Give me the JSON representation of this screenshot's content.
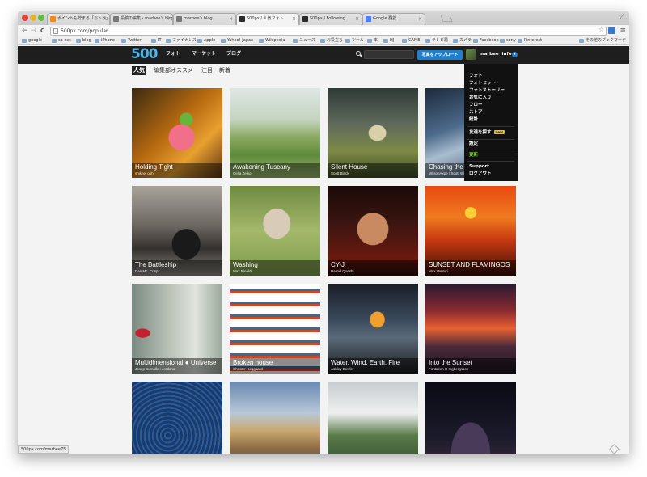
{
  "browser": {
    "tabs": [
      {
        "label": "ポイントも貯まる「おトク」",
        "color": "#f08a24"
      },
      {
        "label": "投稿の編集 ‹ marbee's blog",
        "color": "#777777"
      },
      {
        "label": "marbee's blog",
        "color": "#777777"
      },
      {
        "label": "500px / 人気フォト",
        "color": "#2a2a2a"
      },
      {
        "label": "500px / Following",
        "color": "#2a2a2a"
      },
      {
        "label": "Google 翻訳",
        "color": "#4285f4"
      }
    ],
    "tab_close": "×",
    "active_tab_index": 3,
    "url": "500px.com/popular",
    "status_url": "500px.com/marbee75",
    "bookmarks": [
      "google",
      "so-net",
      "blog",
      "iPhone",
      "Twitter",
      "IT",
      "ファイナンス",
      "Apple",
      "Yahoo! Japan",
      "Wikipedia",
      "ニュース",
      "お役立ち",
      "ツール",
      "本",
      "HJ",
      "CAME",
      "テレビ局",
      "カメラ",
      "Facebook",
      "sony",
      "Pinterest"
    ],
    "bookmarks_other": "その他のブックマーク",
    "icons": {
      "back": "←",
      "forward": "→",
      "reload": "C",
      "star": "☆",
      "menu": "≡",
      "fullscreen": "⤢"
    }
  },
  "site": {
    "logo": "500",
    "brand_color": "#4fb3e8",
    "nav": [
      "フォト",
      "マーケット",
      "ブログ"
    ],
    "search_placeholder": "",
    "upload_label": "写真をアップロード",
    "username": "marbee .info",
    "user_chevron": "▾",
    "subnav": [
      "人気",
      "編集部オススメ",
      "注目",
      "新着"
    ],
    "subnav_active": "人気"
  },
  "dropdown": {
    "items": [
      "フォト",
      "フォトセット",
      "フォトストーリー",
      "お気に入り",
      "フロー",
      "ストア",
      "統計"
    ],
    "invite": "友達を探す",
    "invite_badge": "new",
    "settings": "設定",
    "upgrade": "更新",
    "support": "Support",
    "logout": "ログアウト"
  },
  "photos": [
    {
      "title": "Holding Tight",
      "author": "shikhei goh",
      "bg": "radial-gradient(circle at 55% 55%, #f26f8a 0 18%, transparent 19%), radial-gradient(circle at 60% 35%, #6ab43c 0 8%, transparent 9%), linear-gradient(135deg,#3a2a10,#b86a10 45%,#e8a030 70%,#5a3410)"
    },
    {
      "title": "Awakening Tuscany",
      "author": "Celia Zeiko",
      "bg": "linear-gradient(#dfe7e4 0%,#c4d4c0 35%,#8aa860 55%,#5f8a3a 75%,#9cb870 100%)"
    },
    {
      "title": "Silent House",
      "author": "Scott Black",
      "bg": "radial-gradient(ellipse at 55% 50%, #d9cfa8 0 12%, transparent 13%), linear-gradient(#2e3a36 0%,#5f6a5c 40%,#7d8a46 70%,#3c4a22 100%)"
    },
    {
      "title": "Chasing the Li",
      "author": "WilsonAxpe / Scott Wilson",
      "bg": "linear-gradient(160deg,#1c2a3c 0%,#4c6a8a 40%,#a9bdd0 60%,#2a3a50 100%)"
    },
    {
      "title": "The Battleship",
      "author": "Dan Mc. Crisp",
      "bg": "radial-gradient(ellipse at 60% 65%, #1a1a1a 0 18%, transparent 19%), linear-gradient(#a8a39a 0%,#6a6560 45%,#34312e 70%,#8a8580 100%)"
    },
    {
      "title": "Washing",
      "author": "Max Rinaldi",
      "bg": "radial-gradient(ellipse at 52% 42%, #d8ccb8 0 20%, transparent 21%), linear-gradient(#6f8a42,#a4b86a 50%,#7a9a4a)"
    },
    {
      "title": "CY-J",
      "author": "Hamid Queshi",
      "bg": "radial-gradient(ellipse at 50% 48%, #c98a62 0 24%, transparent 25%), linear-gradient(#1a0a08,#3a1410 40%,#6a1a10 80%,#2a0a08)"
    },
    {
      "title": "SUNSET AND FLAMINGOS",
      "author": "Max Venturi",
      "bg": "radial-gradient(circle at 50% 30%, #ffcf3a 0 7%, transparent 8%), linear-gradient(#e84a10 0%,#f07a20 35%,#c83a10 60%,#3a0e06 100%)"
    },
    {
      "title": "Multidimensional ● Universe",
      "author": "Josep Sumalla i Jordana",
      "bg": "radial-gradient(ellipse at 12% 55%, #c02030 0 6%, transparent 7%), linear-gradient(90deg,#7a8a80,#b8c0b6 40%,#e0e4dc 70%,#9aa89c)"
    },
    {
      "title": "Broken house",
      "author": "Christer Hoggaard",
      "bg": "repeating-linear-gradient(#ffffff 0 6px,#3a6a9a 6px 9px,#c84a2a 9px 12px,#ffffff 12px 16px), linear-gradient(#fff,#ddd)"
    },
    {
      "title": "Water, Wind, Earth, Fire",
      "author": "Ashley Bowler",
      "bg": "radial-gradient(ellipse at 55% 40%, #f0a030 0 10%, transparent 11%), linear-gradient(#1a1e28 0%,#3a4a5a 40%,#5a6a7a 60%,#1a1a1a 100%)"
    },
    {
      "title": "Into the Sunset",
      "author": "Fontainm H Ingbergsson",
      "bg": "linear-gradient(#2a1a30 0%,#8a2a30 30%,#e86030 50%,#4a2a3a 70%,#1a1420 100%)"
    },
    {
      "title": "",
      "author": "",
      "bg": "repeating-radial-gradient(circle at 40% 60%, #1a3a6a 0 3px, #2a5a9a 3px 5px), linear-gradient(#1a3a6a,#3a6aa0)"
    },
    {
      "title": "",
      "author": "",
      "bg": "linear-gradient(#6a88b0 0%,#b8c8d8 35%,#c8a870 55%,#8a6a40 75%,#4a5a7a 100%)"
    },
    {
      "title": "",
      "author": "",
      "bg": "linear-gradient(#c8ccd0 0%,#eef0f0 35%,#5a7a4a 60%,#2a4a2a 100%)"
    },
    {
      "title": "",
      "author": "",
      "bg": "radial-gradient(ellipse at 50% 80%, #4a3a5a 0 30%, transparent 31%), linear-gradient(#0a0a14,#1a1a2a 60%,#3a2a3a)"
    }
  ]
}
